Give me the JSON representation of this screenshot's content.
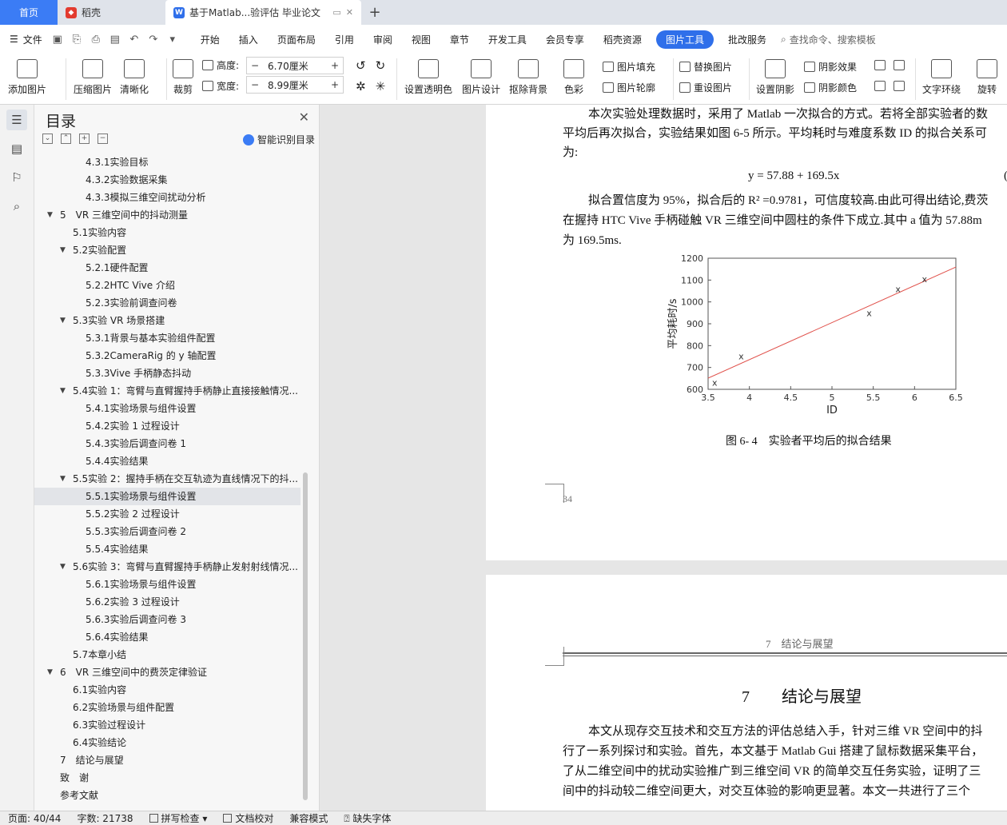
{
  "tabs": {
    "home": "首页",
    "daoke": "稻壳",
    "doc": "基于Matlab...验评估 毕业论文"
  },
  "menu": {
    "file": "文件",
    "items": [
      "开始",
      "插入",
      "页面布局",
      "引用",
      "审阅",
      "视图",
      "章节",
      "开发工具",
      "会员专享",
      "稻壳资源"
    ],
    "picture_tools": "图片工具",
    "batch": "批改服务",
    "search_placeholder": "查找命令、搜索模板"
  },
  "ribbon": {
    "add_picture": "添加图片",
    "compress": "压缩图片",
    "sharpen": "清晰化",
    "crop": "裁剪",
    "height_label": "高度:",
    "height_value": "6.70厘米",
    "width_label": "宽度:",
    "width_value": "8.99厘米",
    "set_transparent": "设置透明色",
    "pic_design": "图片设计",
    "remove_bg": "抠除背景",
    "color": "色彩",
    "pic_fill": "图片填充",
    "pic_outline": "图片轮廓",
    "replace_pic": "替换图片",
    "reset_pic": "重设图片",
    "set_shadow": "设置阴影",
    "shadow_effect": "阴影效果",
    "shadow_color": "阴影颜色",
    "text_wrap": "文字环绕",
    "rotate": "旋转"
  },
  "toc": {
    "title": "目录",
    "smart": "智能识别目录",
    "items": [
      {
        "text": "4.3.1实验目标",
        "level": 3
      },
      {
        "text": "4.3.2实验数据采集",
        "level": 3
      },
      {
        "text": "4.3.3模拟三维空间扰动分析",
        "level": 3
      },
      {
        "text": "5　VR 三维空间中的抖动测量",
        "level": 1,
        "toggle": true
      },
      {
        "text": "5.1实验内容",
        "level": 2
      },
      {
        "text": "5.2实验配置",
        "level": 2,
        "toggle": true
      },
      {
        "text": "5.2.1硬件配置",
        "level": 3
      },
      {
        "text": "5.2.2HTC Vive 介绍",
        "level": 3
      },
      {
        "text": "5.2.3实验前调查问卷",
        "level": 3
      },
      {
        "text": "5.3实验 VR 场景搭建",
        "level": 2,
        "toggle": true
      },
      {
        "text": "5.3.1背景与基本实验组件配置",
        "level": 3
      },
      {
        "text": "5.3.2CameraRig 的 y 轴配置",
        "level": 3
      },
      {
        "text": "5.3.3Vive 手柄静态抖动",
        "level": 3
      },
      {
        "text": "5.4实验 1：弯臂与直臂握持手柄静止直接接触情况...",
        "level": 2,
        "toggle": true
      },
      {
        "text": "5.4.1实验场景与组件设置",
        "level": 3
      },
      {
        "text": "5.4.2实验 1 过程设计",
        "level": 3
      },
      {
        "text": "5.4.3实验后调查问卷 1",
        "level": 3
      },
      {
        "text": "5.4.4实验结果",
        "level": 3
      },
      {
        "text": "5.5实验 2：握持手柄在交互轨迹为直线情况下的抖...",
        "level": 2,
        "toggle": true
      },
      {
        "text": "5.5.1实验场景与组件设置",
        "level": 3,
        "selected": true
      },
      {
        "text": "5.5.2实验 2 过程设计",
        "level": 3
      },
      {
        "text": "5.5.3实验后调查问卷 2",
        "level": 3
      },
      {
        "text": "5.5.4实验结果",
        "level": 3
      },
      {
        "text": "5.6实验 3：弯臂与直臂握持手柄静止发射射线情况...",
        "level": 2,
        "toggle": true
      },
      {
        "text": "5.6.1实验场景与组件设置",
        "level": 3
      },
      {
        "text": "5.6.2实验 3 过程设计",
        "level": 3
      },
      {
        "text": "5.6.3实验后调查问卷 3",
        "level": 3
      },
      {
        "text": "5.6.4实验结果",
        "level": 3
      },
      {
        "text": "5.7本章小结",
        "level": 2
      },
      {
        "text": "6　VR 三维空间中的费茨定律验证",
        "level": 1,
        "toggle": true
      },
      {
        "text": "6.1实验内容",
        "level": 2
      },
      {
        "text": "6.2实验场景与组件配置",
        "level": 2
      },
      {
        "text": "6.3实验过程设计",
        "level": 2
      },
      {
        "text": "6.4实验结论",
        "level": 2
      },
      {
        "text": "7　结论与展望",
        "level": 0
      },
      {
        "text": "致　谢",
        "level": 0
      },
      {
        "text": "参考文献",
        "level": 0
      }
    ]
  },
  "doc": {
    "p1_line1": "本次实验处理数据时，采用了 Matlab 一次拟合的方式。若将全部实验者的数",
    "p1_line2": "平均后再次拟合，实验结果如图 6-5 所示。平均耗时与难度系数 ID 的拟合关系可",
    "p1_line3": "为:",
    "equation": "y  =  57.88  +  169.5x",
    "eq_num": "(",
    "p2_line1": "拟合置信度为 95%，拟合后的 R² =0.9781，可信度较高.由此可得出结论,费茨",
    "p2_line2": "在握持 HTC Vive 手柄碰触 VR 三维空间中圆柱的条件下成立.其中 a 值为 57.88m",
    "p2_line3": "为 169.5ms.",
    "figure_caption": "图 6- 4　实验者平均后的拟合结果",
    "page_number": "34",
    "header2": "7　结论与展望",
    "chapter_title": "7　　结论与展望",
    "p3_line1": "本文从现存交互技术和交互方法的评估总结入手，针对三维 VR 空间中的抖",
    "p3_line2": "行了一系列探讨和实验。首先，本文基于 Matlab Gui 搭建了鼠标数据采集平台，",
    "p3_line3": "了从二维空间中的扰动实验推广到三维空间 VR 的简单交互任务实验，证明了三",
    "p3_line4": "间中的抖动较二维空间更大，对交互体验的影响更显著。本文一共进行了三个"
  },
  "chart_data": {
    "type": "scatter",
    "xlabel": "ID",
    "ylabel": "平均耗时/s",
    "xlim": [
      3.5,
      6.5
    ],
    "ylim": [
      600,
      1200
    ],
    "xticks": [
      "3.5",
      "4",
      "4.5",
      "5",
      "5.5",
      "6",
      "6.5"
    ],
    "yticks": [
      "600",
      "700",
      "800",
      "900",
      "1000",
      "1100",
      "1200"
    ],
    "points": [
      [
        3.58,
        632
      ],
      [
        3.9,
        752
      ],
      [
        5.45,
        950
      ],
      [
        5.8,
        1060
      ],
      [
        6.12,
        1105
      ]
    ],
    "fit_line": {
      "intercept": 57.88,
      "slope": 169.5,
      "color": "#e0504a"
    },
    "marker": "x"
  },
  "status": {
    "page": "页面: 40/44",
    "words": "字数: 21738",
    "spell": "拼写检查",
    "proof": "文档校对",
    "compat": "兼容模式",
    "missing_font": "缺失字体"
  }
}
